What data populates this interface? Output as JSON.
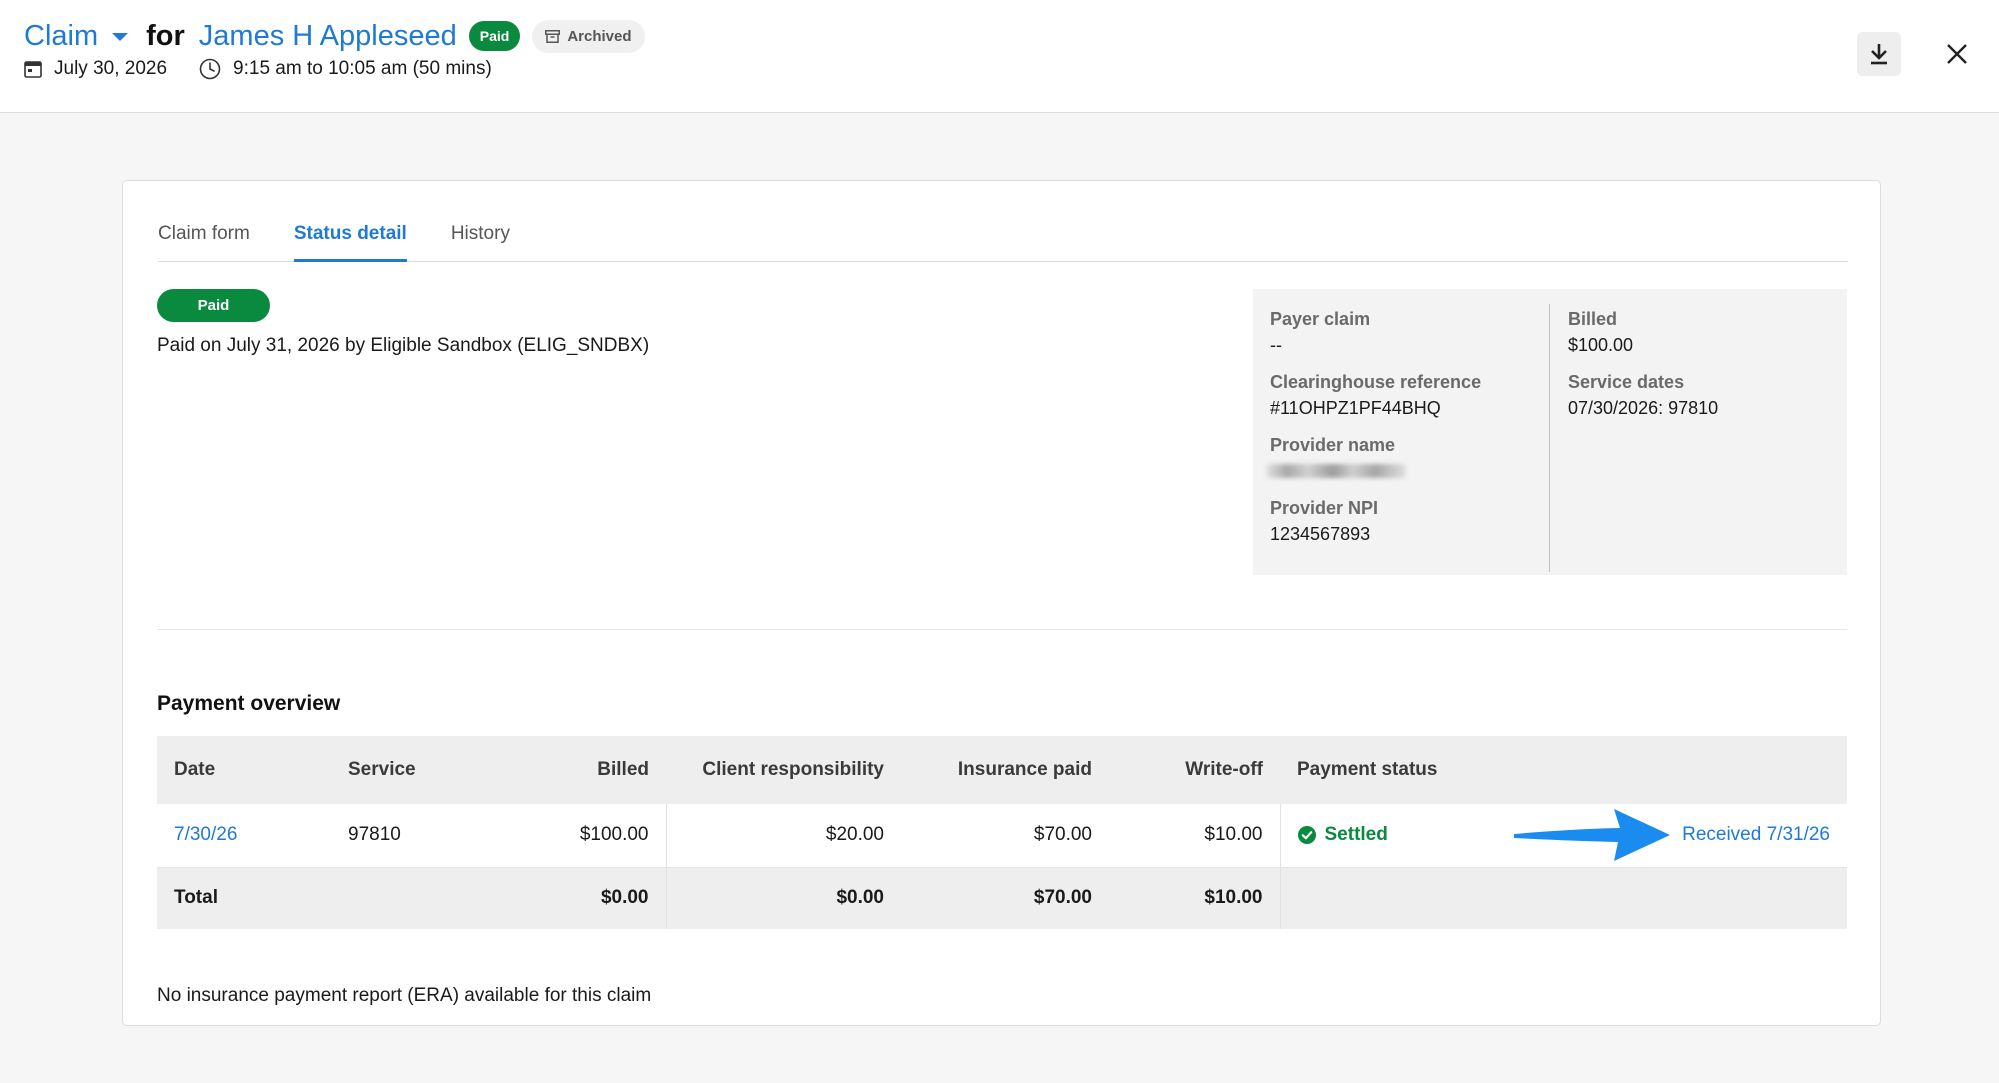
{
  "header": {
    "claim_label": "Claim",
    "for_label": "for",
    "client_name": "James H Appleseed",
    "paid_badge": "Paid",
    "archived_badge": "Archived",
    "date": "July 30, 2026",
    "time": "9:15 am to 10:05 am (50 mins)"
  },
  "icons": {
    "claim_menu": "chevron-down-icon",
    "archived": "archive-box-icon",
    "date": "calendar-icon",
    "time": "clock-icon",
    "download": "download-icon",
    "close": "close-icon",
    "settled": "check-circle-icon",
    "annotation": "blue-arrow-icon"
  },
  "tabs": [
    {
      "label": "Claim form",
      "active": false
    },
    {
      "label": "Status detail",
      "active": true
    },
    {
      "label": "History",
      "active": false
    }
  ],
  "status": {
    "pill": "Paid",
    "description": "Paid on July 31, 2026 by Eligible Sandbox (ELIG_SNDBX)"
  },
  "info": {
    "payer_claim_label": "Payer claim",
    "payer_claim_value": "--",
    "clearinghouse_label": "Clearinghouse reference",
    "clearinghouse_value": "#11OHPZ1PF44BHQ",
    "provider_name_label": "Provider name",
    "provider_npi_label": "Provider NPI",
    "provider_npi_value": "1234567893",
    "billed_label": "Billed",
    "billed_value": "$100.00",
    "service_dates_label": "Service dates",
    "service_dates_value": "07/30/2026: 97810"
  },
  "payment_overview": {
    "title": "Payment overview",
    "columns": [
      "Date",
      "Service",
      "Billed",
      "Client responsibility",
      "Insurance paid",
      "Write-off",
      "Payment status"
    ],
    "row": {
      "date": "7/30/26",
      "service": "97810",
      "billed": "$100.00",
      "client_responsibility": "$20.00",
      "insurance_paid": "$70.00",
      "write_off": "$10.00",
      "status": "Settled",
      "received": "Received 7/31/26"
    },
    "total": {
      "label": "Total",
      "billed": "$0.00",
      "client_responsibility": "$0.00",
      "insurance_paid": "$70.00",
      "write_off": "$10.00"
    }
  },
  "footer_note": "No insurance payment report (ERA) available for this claim",
  "colors": {
    "accent": "#1f7ad6",
    "success": "#0a8a3e",
    "annotation_arrow": "#1a8cf0"
  }
}
